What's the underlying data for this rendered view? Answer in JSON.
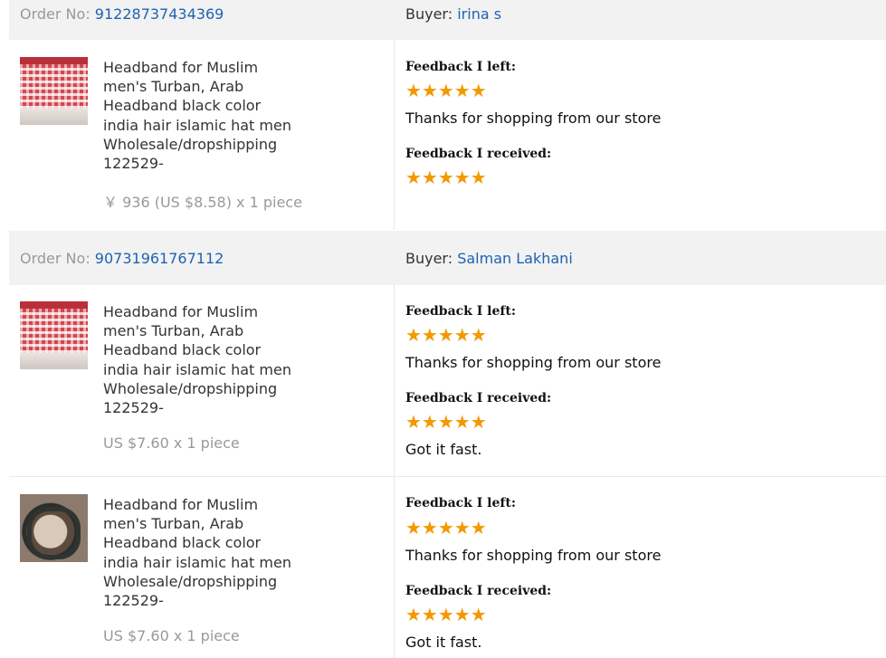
{
  "orders": [
    {
      "order_no_label": "Order No:",
      "order_no": "91228737434369",
      "buyer_label": "Buyer:",
      "buyer_name": "irina s",
      "items": [
        {
          "thumbnail": "red-checkered-headscarf",
          "title": "Headband for Muslim men's Turban, Arab Headband black color india hair islamic hat men Wholesale/dropshipping 122529-",
          "price": "￥ 936 (US $8.58) x 1 piece",
          "feedback_left_label": "Feedback I left:",
          "feedback_left_stars": "★★★★★",
          "feedback_left_text": "Thanks for shopping from our store",
          "feedback_received_label": "Feedback I received:",
          "feedback_received_stars": "★★★★★",
          "feedback_received_text": ""
        }
      ]
    },
    {
      "order_no_label": "Order No:",
      "order_no": "90731961767112",
      "buyer_label": "Buyer:",
      "buyer_name": "Salman Lakhani",
      "items": [
        {
          "thumbnail": "red-checkered-headscarf",
          "title": "Headband for Muslim men's Turban, Arab Headband black color india hair islamic hat men Wholesale/dropshipping 122529-",
          "price": "US $7.60 x 1 piece",
          "feedback_left_label": "Feedback I left:",
          "feedback_left_stars": "★★★★★",
          "feedback_left_text": "Thanks for shopping from our store",
          "feedback_received_label": "Feedback I received:",
          "feedback_received_stars": "★★★★★",
          "feedback_received_text": "Got it fast."
        },
        {
          "thumbnail": "black-hose-coil",
          "title": "Headband for Muslim men's Turban, Arab Headband black color india hair islamic hat men Wholesale/dropshipping 122529-",
          "price": "US $7.60 x 1 piece",
          "feedback_left_label": "Feedback I left:",
          "feedback_left_stars": "★★★★★",
          "feedback_left_text": "Thanks for shopping from our store",
          "feedback_received_label": "Feedback I received:",
          "feedback_received_stars": "★★★★★",
          "feedback_received_text": "Got it fast."
        }
      ]
    }
  ],
  "colors": {
    "link": "#1e62b2",
    "star": "#f39800",
    "header_bg": "#f2f2f2",
    "muted": "#999999"
  }
}
